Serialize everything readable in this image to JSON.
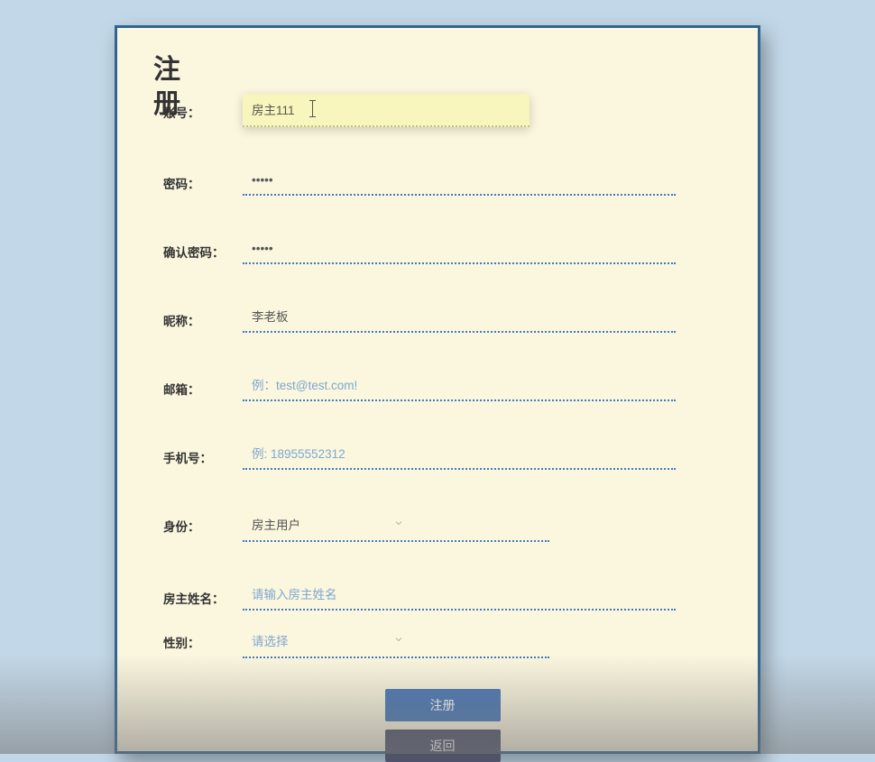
{
  "title": "注册",
  "fields": {
    "account": {
      "label": "账号：",
      "value": "房主111"
    },
    "password": {
      "label": "密码：",
      "value": "•••••"
    },
    "confirm": {
      "label": "确认密码：",
      "value": "•••••"
    },
    "nickname": {
      "label": "昵称：",
      "value": "李老板"
    },
    "email": {
      "label": "邮箱：",
      "placeholder": "例：test@test.com!"
    },
    "phone": {
      "label": "手机号：",
      "placeholder": "例: 18955552312"
    },
    "role": {
      "label": "身份：",
      "value": "房主用户"
    },
    "ownerName": {
      "label": "房主姓名：",
      "placeholder": "请输入房主姓名"
    },
    "gender": {
      "label": "性别：",
      "placeholder": "请选择"
    }
  },
  "buttons": {
    "submit": "注册",
    "back": "返回"
  }
}
